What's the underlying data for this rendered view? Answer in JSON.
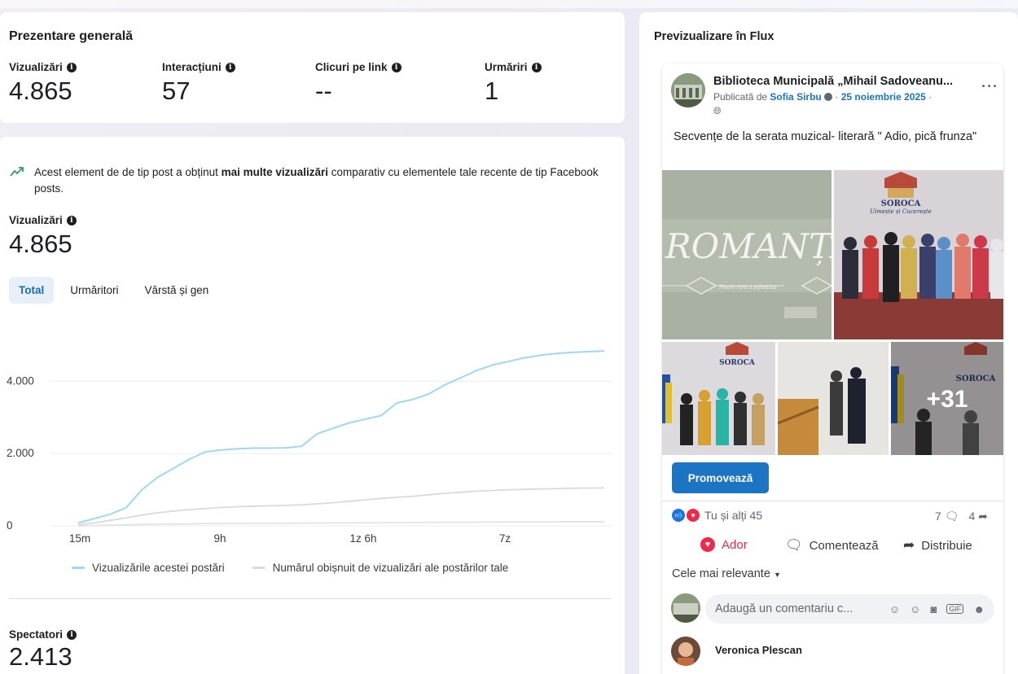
{
  "overview": {
    "title": "Prezentare generală",
    "metrics": [
      {
        "label": "Vizualizări",
        "value": "4.865"
      },
      {
        "label": "Interacțiuni",
        "value": "57"
      },
      {
        "label": "Clicuri pe link",
        "value": "--"
      },
      {
        "label": "Urmăriri",
        "value": "1"
      }
    ]
  },
  "insight": {
    "text_before": "Acest element de de tip post a obținut ",
    "text_bold": "mai multe vizualizări",
    "text_after": " comparativ cu elementele tale recente de tip Facebook posts."
  },
  "views": {
    "label": "Vizualizări",
    "value": "4.865"
  },
  "tabs": [
    "Total",
    "Urmăritori",
    "Vârstă și gen"
  ],
  "chart_data": {
    "type": "line",
    "x_tick_labels": [
      "15m",
      "9h",
      "1z 6h",
      "7z"
    ],
    "y_tick_labels": [
      "0",
      "2.000",
      "4.000"
    ],
    "ylim": [
      0,
      4865
    ],
    "series": [
      {
        "name": "Vizualizările acestei postări",
        "color": "#9fd8f2",
        "values": [
          80,
          200,
          320,
          500,
          1000,
          1350,
          1600,
          1850,
          2050,
          2100,
          2130,
          2150,
          2150,
          2160,
          2200,
          2550,
          2700,
          2850,
          2950,
          3050,
          3400,
          3500,
          3650,
          3900,
          4100,
          4300,
          4450,
          4550,
          4650,
          4720,
          4770,
          4800,
          4820,
          4840
        ]
      },
      {
        "name": "Numărul obișnuit de vizualizări ale postărilor tale",
        "color": "#d9dadc",
        "values": [
          30,
          80,
          150,
          220,
          300,
          360,
          410,
          450,
          480,
          510,
          530,
          545,
          555,
          565,
          580,
          610,
          640,
          680,
          720,
          760,
          790,
          820,
          860,
          900,
          930,
          960,
          980,
          1000,
          1010,
          1020,
          1030,
          1040,
          1045,
          1050
        ]
      },
      {
        "name": "",
        "color": "#e2e3e5",
        "values": [
          0,
          10,
          20,
          30,
          40,
          45,
          50,
          55,
          60,
          62,
          65,
          68,
          70,
          72,
          75,
          78,
          80,
          82,
          85,
          88,
          90,
          92,
          95,
          98,
          100,
          102,
          104,
          106,
          108,
          110,
          112,
          114,
          115,
          116
        ]
      }
    ],
    "grid": true
  },
  "spectators": {
    "label": "Spectatori",
    "value": "2.413"
  },
  "preview": {
    "title": "Previzualizare în Flux",
    "page_name": "Biblioteca Municipală „Mihail Sadoveanu...",
    "published_by": "Publicată de",
    "author": "Sofia Sirbu",
    "date": "25 noiembrie 2025",
    "post_text": "Secvențe de la serata muzical- literară \" Adio, pică frunza\"",
    "photo1_text": "ROMANȚA",
    "photo1_sub": "Floare rară a sufletului",
    "logo_city": "SOROCA",
    "logo_slogan": "Uimește și Cucerește",
    "more_photos": "+31",
    "promote_label": "Promovează",
    "reactions_text": "Tu și alți 45",
    "comments_count": "7",
    "shares_count": "4",
    "actions": {
      "like": "Ador",
      "comment": "Comentează",
      "share": "Distribuie"
    },
    "sort_label": "Cele mai relevante",
    "comment_placeholder": "Adaugă un comentariu c...",
    "commenter": "Veronica Plescan"
  },
  "colors": {
    "accent": "#1b74c4",
    "series_main": "#9fd8f2",
    "series_avg": "#d9dadc",
    "love": "#f0284a"
  }
}
